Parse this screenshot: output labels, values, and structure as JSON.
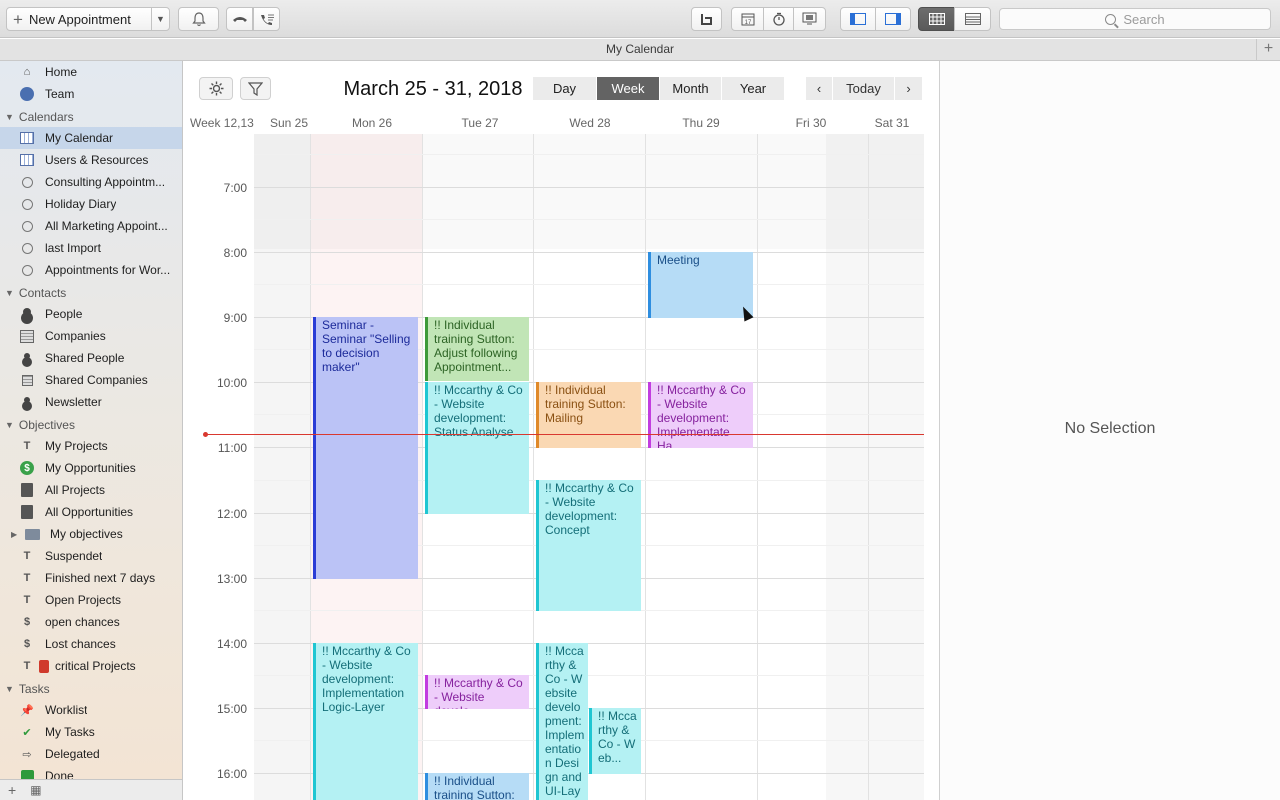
{
  "toolbar": {
    "new_appointment_label": "New Appointment",
    "search_placeholder": "Search",
    "icons": [
      "bell-icon",
      "phone-hangup-icon",
      "phone-call-icon",
      "app-icon",
      "calendar-17-icon",
      "timer-icon",
      "transfer-icon",
      "sidebar-left-icon",
      "sidebar-right-icon",
      "grid-view-icon",
      "list-view-icon"
    ]
  },
  "window": {
    "title": "My Calendar"
  },
  "sidebar": {
    "top_items": [
      {
        "label": "Home",
        "icon": "home-icon"
      },
      {
        "label": "Team",
        "icon": "team-icon"
      }
    ],
    "sections": [
      {
        "title": "Calendars",
        "items": [
          {
            "label": "My Calendar",
            "icon": "calendar-icon",
            "selected": true
          },
          {
            "label": "Users & Resources",
            "icon": "calendar-icon"
          },
          {
            "label": "Consulting Appointm...",
            "icon": "clock-icon"
          },
          {
            "label": "Holiday Diary",
            "icon": "clock-icon"
          },
          {
            "label": "All Marketing Appoint...",
            "icon": "clock-icon"
          },
          {
            "label": "last Import",
            "icon": "clock-icon"
          },
          {
            "label": "Appointments for Wor...",
            "icon": "clock-icon"
          }
        ]
      },
      {
        "title": "Contacts",
        "items": [
          {
            "label": "People",
            "icon": "person-icon"
          },
          {
            "label": "Companies",
            "icon": "company-icon"
          },
          {
            "label": "Shared People",
            "icon": "shared-person-icon"
          },
          {
            "label": "Shared Companies",
            "icon": "shared-company-icon"
          },
          {
            "label": "Newsletter",
            "icon": "newsletter-icon"
          }
        ]
      },
      {
        "title": "Objectives",
        "items": [
          {
            "label": "My Projects",
            "icon": "project-icon"
          },
          {
            "label": "My Opportunities",
            "icon": "dollar-icon"
          },
          {
            "label": "All Projects",
            "icon": "book-icon"
          },
          {
            "label": "All Opportunities",
            "icon": "book-dollar-icon"
          },
          {
            "label": "My objectives",
            "icon": "folder-icon"
          },
          {
            "label": "Suspendet",
            "icon": "smart-project-icon"
          },
          {
            "label": "Finished next 7 days",
            "icon": "smart-project-icon"
          },
          {
            "label": "Open Projects",
            "icon": "smart-project-icon"
          },
          {
            "label": "open chances",
            "icon": "smart-dollar-icon"
          },
          {
            "label": "Lost chances",
            "icon": "smart-dollar-icon"
          },
          {
            "label": "critical Projects",
            "icon": "smart-critical-icon"
          }
        ]
      },
      {
        "title": "Tasks",
        "items": [
          {
            "label": "Worklist",
            "icon": "pin-icon"
          },
          {
            "label": "My Tasks",
            "icon": "check-icon"
          },
          {
            "label": "Delegated",
            "icon": "delegate-arrow-icon"
          },
          {
            "label": "Done",
            "icon": "done-icon"
          }
        ]
      }
    ]
  },
  "calendar": {
    "range_title": "March 25 - 31, 2018",
    "views": [
      "Day",
      "Week",
      "Month",
      "Year"
    ],
    "active_view": "Week",
    "today_label": "Today",
    "week_label": "Week 12,13",
    "days": [
      "Sun 25",
      "Mon 26",
      "Tue 27",
      "Wed 28",
      "Thu 29",
      "Fri 30",
      "Sat 31"
    ],
    "hours": [
      "7:00",
      "8:00",
      "9:00",
      "10:00",
      "11:00",
      "12:00",
      "13:00",
      "14:00",
      "15:00",
      "16:00"
    ],
    "events": [
      {
        "day": "Mon 26",
        "start": "9:00",
        "end": "13:00",
        "title": "Seminar - Seminar \"Selling to decision maker\"",
        "color": "blue"
      },
      {
        "day": "Mon 26",
        "start": "14:00",
        "end": "16:30",
        "title": "!! Mccarthy & Co - Website development: Implementation Logic-Layer",
        "color": "cyan"
      },
      {
        "day": "Tue 27",
        "start": "9:00",
        "end": "10:00",
        "title": "!! Individual training Sutton: Adjust following Appointment...",
        "color": "green"
      },
      {
        "day": "Tue 27",
        "start": "10:00",
        "end": "12:00",
        "title": "!! Mccarthy & Co - Website development: Status Analyse",
        "color": "cyan"
      },
      {
        "day": "Tue 27",
        "start": "14:30",
        "end": "15:00",
        "title": "!! Mccarthy & Co - Website develo...",
        "color": "purple"
      },
      {
        "day": "Tue 27",
        "start": "16:00",
        "end": "16:30",
        "title": "!! Individual training Sutton:",
        "color": "lightblue"
      },
      {
        "day": "Wed 28",
        "start": "10:00",
        "end": "11:00",
        "title": "!! Individual training Sutton: Mailing",
        "color": "orange"
      },
      {
        "day": "Wed 28",
        "start": "11:30",
        "end": "13:30",
        "title": "!! Mccarthy & Co - Website development: Concept",
        "color": "cyan"
      },
      {
        "day": "Wed 28",
        "start": "14:00",
        "end": "16:30",
        "title": "!! Mccarthy & Co - Website development: Implementation Design and UI-Layer",
        "color": "cyan"
      },
      {
        "day": "Wed 28",
        "start": "15:00",
        "end": "16:00",
        "title": "!! Mccarthy & Co - Web...",
        "color": "cyan"
      },
      {
        "day": "Thu 29",
        "start": "8:00",
        "end": "9:00",
        "title": "Meeting",
        "color": "lightblue"
      },
      {
        "day": "Thu 29",
        "start": "10:00",
        "end": "11:00",
        "title": "!! Mccarthy & Co - Website development: Implementate Ha...",
        "color": "purple"
      }
    ]
  },
  "inspector": {
    "empty_text": "No Selection"
  },
  "colors": {
    "accent_selected": "#c6d6ea",
    "now_line": "#d9382f",
    "active_segment": "#636363"
  }
}
